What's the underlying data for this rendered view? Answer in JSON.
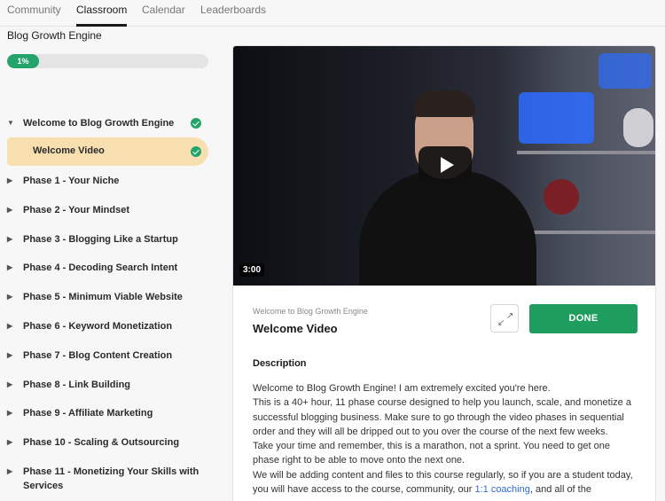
{
  "nav": {
    "tabs": [
      "Community",
      "Classroom",
      "Calendar",
      "Leaderboards"
    ],
    "active_tab": "Classroom"
  },
  "course": {
    "title": "Blog Growth Engine",
    "progress_label": "1%",
    "progress_value": 0.01
  },
  "modules": [
    {
      "label": "Welcome to Blog Growth Engine",
      "expanded": true,
      "completed": true,
      "lessons": [
        {
          "label": "Welcome Video",
          "completed": true,
          "active": true
        }
      ]
    },
    {
      "label": "Phase 1 - Your Niche"
    },
    {
      "label": "Phase 2 - Your Mindset"
    },
    {
      "label": "Phase 3 - Blogging Like a Startup"
    },
    {
      "label": "Phase 4 - Decoding Search Intent"
    },
    {
      "label": "Phase 5 - Minimum Viable Website"
    },
    {
      "label": "Phase 6 - Keyword Monetization"
    },
    {
      "label": "Phase 7 - Blog Content Creation"
    },
    {
      "label": "Phase 8 - Link Building"
    },
    {
      "label": "Phase 9 - Affiliate Marketing"
    },
    {
      "label": "Phase 10 - Scaling & Outsourcing"
    },
    {
      "label": "Phase 11 - Monetizing Your Skills with Services"
    }
  ],
  "video": {
    "duration": "3:00",
    "icons": {
      "play": "play-icon",
      "expand": "expand-icon",
      "check": "check-circle-icon"
    }
  },
  "lesson": {
    "module_name": "Welcome to Blog Growth Engine",
    "title": "Welcome Video",
    "done_label": "DONE",
    "description_heading": "Description",
    "description_lines": [
      "Welcome to Blog Growth Engine! I am extremely excited you're here.",
      "This is a 40+ hour, 11 phase course designed to help you launch, scale, and monetize a successful blogging business. Make sure to go through the video phases in sequential order and they will all be dripped out to you over the course of the next few weeks.",
      "Take your time and remember, this is a marathon, not a sprint. You need to get one phase right to be able to move onto the next one."
    ],
    "description_last_before_link": "We will be adding content and files to this course regularly, so if you are a student today, you will have access to the course, community, our ",
    "description_link": "1:1 coaching",
    "description_last_after_link": ", and all of the"
  },
  "colors": {
    "accent_green": "#24a36a",
    "done_green": "#1f9d5e",
    "active_lesson_bg": "#f8dfb0",
    "link_blue": "#2f6bd8"
  }
}
